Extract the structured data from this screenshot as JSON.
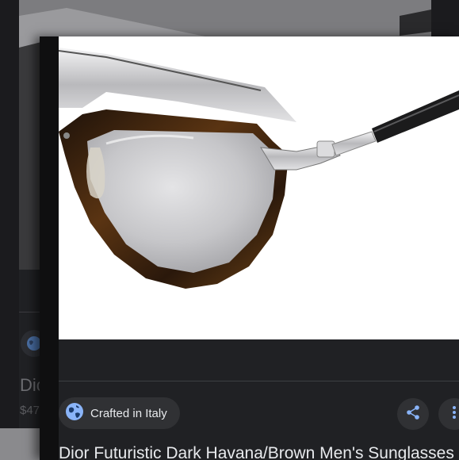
{
  "background_card": {
    "title_partial": "Dic",
    "price_partial": "$47",
    "icon": "globe-icon"
  },
  "product": {
    "chip_label": "Crafted in Italy",
    "chip_icon": "globe-icon",
    "title": "Dior Futuristic Dark Havana/Brown Men's Sunglasses",
    "share_icon": "share-icon",
    "more_icon": "more-vert-icon"
  },
  "colors": {
    "surface": "#202124",
    "chip_bg": "#303134",
    "text_primary": "#e8eaed",
    "accent_blue": "#8ab4f8",
    "havana_brown": "#3a2412",
    "silver": "#c9c9cc"
  }
}
